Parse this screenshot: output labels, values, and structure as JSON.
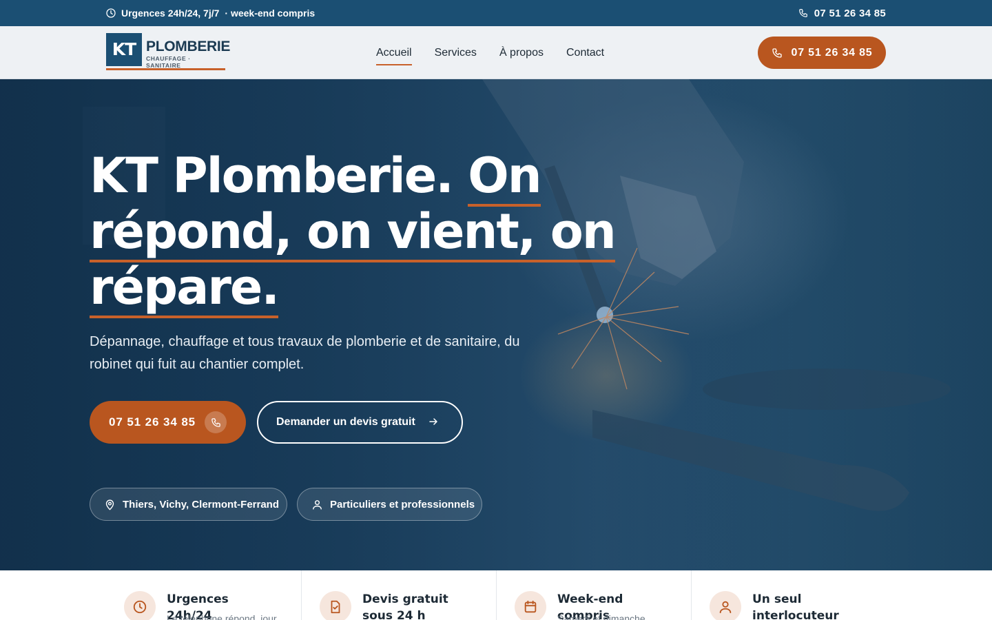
{
  "topbar": {
    "urgences": "Urgences 24h/24, 7j/7",
    "weekend": "· week-end compris",
    "phone": "07 51 26 34 85"
  },
  "logo": {
    "mark": "KT",
    "brand": "PLOMBERIE",
    "tagline": "CHAUFFAGE · SANITAIRE"
  },
  "nav": {
    "items": [
      {
        "label": "Accueil",
        "active": true
      },
      {
        "label": "Services"
      },
      {
        "label": "À propos"
      },
      {
        "label": "Contact"
      }
    ]
  },
  "header": {
    "call_label": "07 51 26 34 85"
  },
  "hero": {
    "headline_1": "KT Plomberie.",
    "headline_2": "On",
    "headline_3": "répond, on vient, on",
    "headline_4": "répare.",
    "subtitle": "Dépannage, chauffage et tous travaux de plomberie et de sanitaire, du robinet qui fuit au chantier complet.",
    "call_button": "07 51 26 34 85",
    "quote_button": "Demander un devis gratuit",
    "pill_location": "Thiers, Vichy, Clermont-Ferrand",
    "pill_audience": "Particuliers et professionnels"
  },
  "features": [
    {
      "icon": "clock-icon",
      "title": "Urgences 24h/24",
      "desc": "Le téléphone répond, jour"
    },
    {
      "icon": "document-check-icon",
      "title": "Devis gratuit sous 24 h",
      "desc": ""
    },
    {
      "icon": "calendar-icon",
      "title": "Week-end compris",
      "desc": "Samedi et dimanche"
    },
    {
      "icon": "user-icon",
      "title": "Un seul interlocuteur",
      "desc": ""
    }
  ],
  "colors": {
    "primary_blue": "#1b4f73",
    "accent_orange": "#b9561f"
  }
}
